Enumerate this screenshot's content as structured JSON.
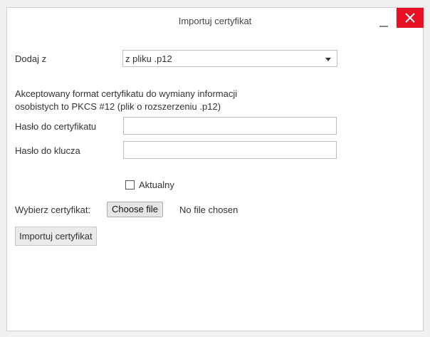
{
  "window": {
    "title": "Importuj certyfikat",
    "minimize_icon": "minimize-icon",
    "close_icon": "close-icon",
    "close_color": "#e81123"
  },
  "form": {
    "source_label": "Dodaj z",
    "source_value": "z pliku .p12",
    "info_line1": "Akceptowany format certyfikatu do wymiany informacji",
    "info_line2": "osobistych to PKCS #12 (plik o rozszerzeniu .p12)",
    "cert_password_label": "Hasło do certyfikatu",
    "cert_password_value": "",
    "key_password_label": "Hasło do klucza",
    "key_password_value": "",
    "current_checkbox_label": "Aktualny",
    "current_checked": false,
    "choose_cert_label": "Wybierz certyfikat:",
    "choose_file_button": "Choose file",
    "file_status": "No file chosen",
    "submit_button": "Importuj certyfikat"
  }
}
